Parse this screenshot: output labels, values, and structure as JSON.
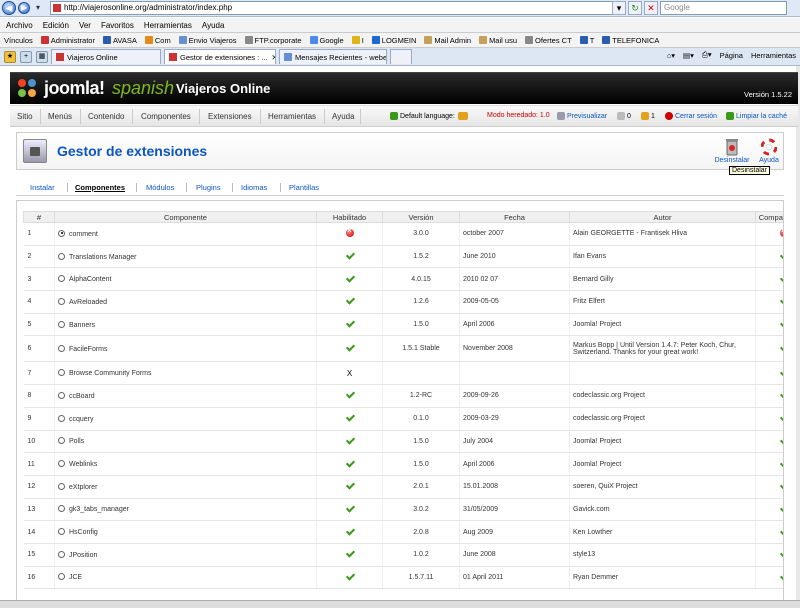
{
  "browser": {
    "url": "http://viajerosonline.org/administrator/index.php",
    "search_placeholder": "Google",
    "menu": [
      "Archivo",
      "Edición",
      "Ver",
      "Favoritos",
      "Herramientas",
      "Ayuda"
    ],
    "favorites_label": "Vínculos",
    "favorites": [
      "Administrator",
      "AVASA",
      "Com",
      "Envio Viajeros",
      "FTP.corporate",
      "Google",
      "I",
      "LOGMEIN",
      "Mail Admin",
      "Mail usu",
      "Ofertes CT",
      "T",
      "TELEFONICA"
    ],
    "tabs": [
      {
        "label": "Viajeros Online",
        "active": false
      },
      {
        "label": "Gestor de extensiones : ...",
        "active": true
      },
      {
        "label": "Mensajes Recientes - webe...",
        "active": false
      }
    ],
    "commands": {
      "page": "Página",
      "tools": "Herramientas"
    }
  },
  "header": {
    "brand": "joomla!",
    "brand_suffix": "spanish",
    "site_name": "Viajeros Online",
    "version": "Versión 1.5.22"
  },
  "menu": {
    "items": [
      "Sitio",
      "Menús",
      "Contenido",
      "Componentes",
      "Extensiones",
      "Herramientas",
      "Ayuda"
    ],
    "default_language": "Default language:",
    "inherited_mode": "Modo heredado: 1.0",
    "preview": "Previsualizar",
    "messages": "0",
    "users": "1",
    "logout": "Cerrar sesión",
    "clear_cache": "Limpiar la caché"
  },
  "toolbar": {
    "title": "Gestor de extensiones",
    "uninstall": "Desinstalar",
    "help": "Ayuda",
    "tooltip": "Desinstalar"
  },
  "submenu": {
    "items": [
      "Instalar",
      "Componentes",
      "Módulos",
      "Plugins",
      "Idiomas",
      "Plantillas"
    ],
    "active": "Componentes"
  },
  "table": {
    "columns": [
      "#",
      "Componente",
      "Habilitado",
      "Versión",
      "Fecha",
      "Autor",
      "Compatibilidad"
    ],
    "rows": [
      {
        "n": "1",
        "name": "comment",
        "enabled": "no",
        "version": "3.0.0",
        "date": "october 2007",
        "author": "Alain GEORGETTE - Frantisek Hliva",
        "compat": "no"
      },
      {
        "n": "2",
        "name": "Translations Manager",
        "enabled": "yes",
        "version": "1.5.2",
        "date": "June 2010",
        "author": "Ifan Evans",
        "compat": "yes"
      },
      {
        "n": "3",
        "name": "AlphaContent",
        "enabled": "yes",
        "version": "4.0.15",
        "date": "2010 02 07",
        "author": "Bernard Gilly",
        "compat": "yes"
      },
      {
        "n": "4",
        "name": "AvReloaded",
        "enabled": "yes",
        "version": "1.2.6",
        "date": "2009-05-05",
        "author": "Fritz Elfert",
        "compat": "yes"
      },
      {
        "n": "5",
        "name": "Banners",
        "enabled": "yes",
        "version": "1.5.0",
        "date": "April 2006",
        "author": "Joomla! Project",
        "compat": "yes"
      },
      {
        "n": "6",
        "name": "FacileForms",
        "enabled": "yes",
        "version": "1.5.1 Stable",
        "date": "November 2008",
        "author": "Markus Bopp | Until Version 1.4.7: Peter Koch, Chur, Switzerland. Thanks for your great work!",
        "compat": "yes"
      },
      {
        "n": "7",
        "name": "Browse Community Forms",
        "enabled": "x",
        "version": "",
        "date": "",
        "author": "",
        "compat": "yes"
      },
      {
        "n": "8",
        "name": "ccBoard",
        "enabled": "yes",
        "version": "1.2-RC",
        "date": "2009-09-26",
        "author": "codeclassic.org Project",
        "compat": "yes"
      },
      {
        "n": "9",
        "name": "ccquery",
        "enabled": "yes",
        "version": "0.1.0",
        "date": "2009-03-29",
        "author": "codeclassic.org Project",
        "compat": "yes"
      },
      {
        "n": "10",
        "name": "Polls",
        "enabled": "yes",
        "version": "1.5.0",
        "date": "July 2004",
        "author": "Joomla! Project",
        "compat": "yes"
      },
      {
        "n": "11",
        "name": "Weblinks",
        "enabled": "yes",
        "version": "1.5.0",
        "date": "April 2006",
        "author": "Joomla! Project",
        "compat": "yes"
      },
      {
        "n": "12",
        "name": "eXtplorer",
        "enabled": "yes",
        "version": "2.0.1",
        "date": "15.01.2008",
        "author": "soeren, QuiX Project",
        "compat": "yes"
      },
      {
        "n": "13",
        "name": "gk3_tabs_manager",
        "enabled": "yes",
        "version": "3.0.2",
        "date": "31/05/2009",
        "author": "Gavick.com",
        "compat": "yes"
      },
      {
        "n": "14",
        "name": "HsConfig",
        "enabled": "yes",
        "version": "2.0.8",
        "date": "Aug 2009",
        "author": "Ken Lowther",
        "compat": "yes"
      },
      {
        "n": "15",
        "name": "JPosition",
        "enabled": "yes",
        "version": "1.0.2",
        "date": "June 2008",
        "author": "style13",
        "compat": "yes"
      },
      {
        "n": "16",
        "name": "JCE",
        "enabled": "yes",
        "version": "1.5.7.11",
        "date": "01 April 2011",
        "author": "Ryan Demmer",
        "compat": "yes"
      }
    ]
  }
}
